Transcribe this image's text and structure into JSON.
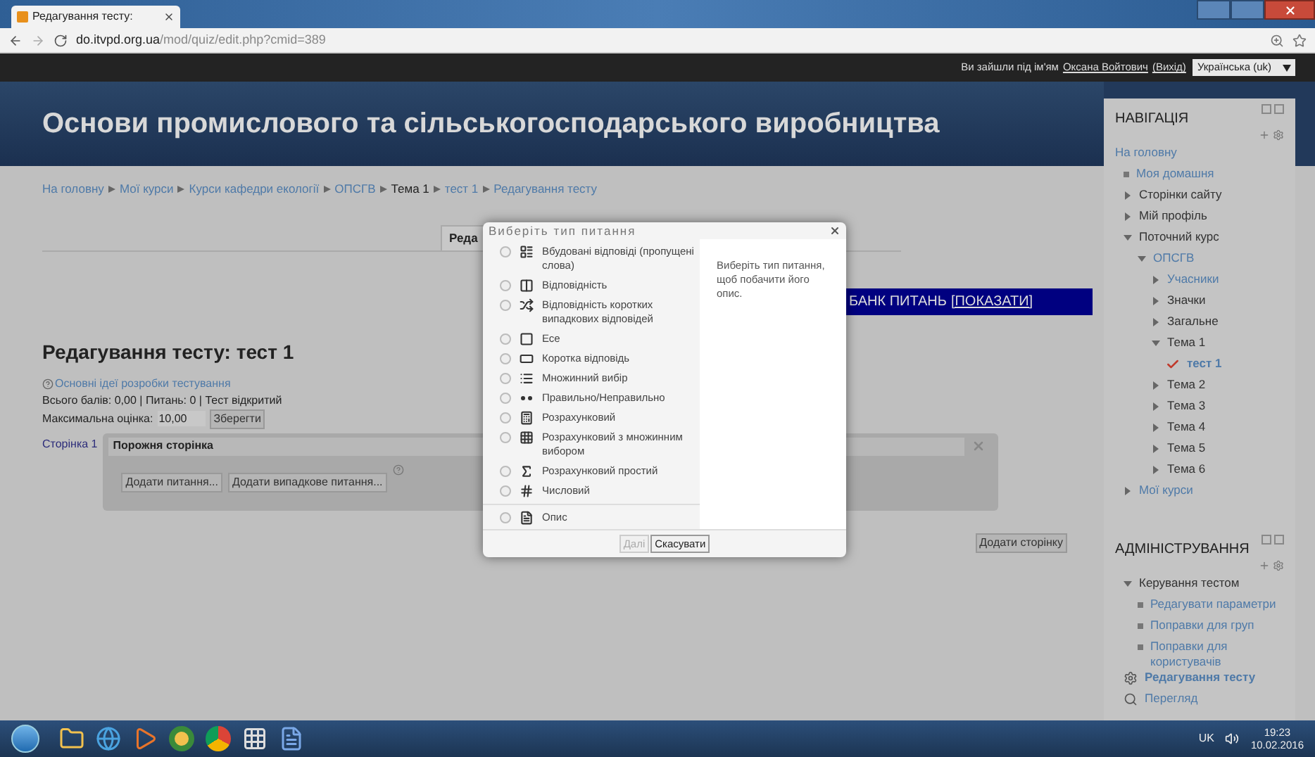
{
  "browser": {
    "tab_title": "Редагування тесту:",
    "address_host": "do.itvpd.org.ua",
    "address_path": "/mod/quiz/edit.php?cmid=389"
  },
  "login_bar": {
    "prefix": "Ви зайшли під ім'ям",
    "user": "Оксана Войтович",
    "logout": "(Вихід)",
    "language": "Українська (uk)"
  },
  "header": {
    "title": "Основи промислового та сільськогосподарського виробництва"
  },
  "breadcrumb": [
    {
      "label": "На головну",
      "link": true
    },
    {
      "label": "Мої курси",
      "link": true
    },
    {
      "label": "Курси кафедри екології",
      "link": true
    },
    {
      "label": "ОПСГВ",
      "link": true
    },
    {
      "label": "Тема 1",
      "link": false
    },
    {
      "label": "тест 1",
      "link": true
    },
    {
      "label": "Редагування тесту",
      "link": true
    }
  ],
  "tab_behind": "Реда",
  "question_bank": {
    "label": "БАНК ПИТАНЬ",
    "action": "[ПОКАЗАТИ]"
  },
  "quiz": {
    "heading": "Редагування тесту: тест 1",
    "help_link": "Основні ідеї розробки тестування",
    "summary": "Всього балів: 0,00 | Питань: 0 | Тест відкритий",
    "max_grade_label": "Максимальна оцінка:",
    "max_grade_value": "10,00",
    "save_button": "Зберегти",
    "page_label": "Сторінка 1",
    "page_title": "Порожня сторінка",
    "buttons": [
      "Додати питання...",
      "Додати випадкове питання..."
    ],
    "add_page_button": "Додати сторінку"
  },
  "dialog": {
    "title": "Виберіть тип питання",
    "question_types": [
      {
        "kind": "embedded",
        "label": "Вбудовані відповіді (пропущені слова)",
        "selected": false
      },
      {
        "kind": "matching",
        "label": "Відповідність",
        "selected": false
      },
      {
        "kind": "random-matching",
        "label": "Відповідність коротких випадкових відповідей",
        "selected": false
      },
      {
        "kind": "essay",
        "label": "Есе",
        "selected": false
      },
      {
        "kind": "short-answer",
        "label": "Коротка відповідь",
        "selected": false
      },
      {
        "kind": "multichoice",
        "label": "Множинний вибір",
        "selected": false
      },
      {
        "kind": "truefalse",
        "label": "Правильно/Неправильно",
        "selected": false
      },
      {
        "kind": "calculated",
        "label": "Розрахунковий",
        "selected": false
      },
      {
        "kind": "calculated-multi",
        "label": "Розрахунковий з множинним вибором",
        "selected": false
      },
      {
        "kind": "calculated-simple",
        "label": "Розрахунковий простий",
        "selected": false
      },
      {
        "kind": "numerical",
        "label": "Числовий",
        "selected": false
      }
    ],
    "other_types": [
      {
        "kind": "description",
        "label": "Опис",
        "selected": false
      }
    ],
    "description": "Виберіть тип питання, щоб побачити його опис.",
    "next_button": {
      "label": "Далі",
      "disabled": true
    },
    "cancel_button": "Скасувати"
  },
  "navigation": {
    "title": "НАВІГАЦІЯ",
    "items": [
      {
        "kind": "home",
        "label": "На головну",
        "link": true,
        "current": false
      },
      {
        "kind": "bullet",
        "label": "Моя домашня",
        "link": true,
        "current": false
      },
      {
        "kind": "branch",
        "label": "Сторінки сайту",
        "link": false,
        "current": false,
        "expanded": false
      },
      {
        "kind": "branch",
        "label": "Мій профіль",
        "link": false,
        "current": false,
        "expanded": false
      },
      {
        "kind": "branch",
        "label": "Поточний курс",
        "link": false,
        "current": false,
        "expanded": true,
        "children": [
          {
            "kind": "branch",
            "label": "ОПСГВ",
            "link": true,
            "current": false,
            "expanded": true,
            "children": [
              {
                "kind": "branch",
                "label": "Учасники",
                "link": true,
                "current": false,
                "expanded": false
              },
              {
                "kind": "branch",
                "label": "Значки",
                "link": false,
                "current": false,
                "expanded": false
              },
              {
                "kind": "branch",
                "label": "Загальне",
                "link": false,
                "current": false,
                "expanded": false
              },
              {
                "kind": "branch",
                "label": "Тема 1",
                "link": false,
                "current": false,
                "expanded": true,
                "children": [
                  {
                    "kind": "activity",
                    "label": "тест 1",
                    "link": true,
                    "current": true
                  }
                ]
              },
              {
                "kind": "branch",
                "label": "Тема 2",
                "link": false,
                "current": false,
                "expanded": false
              },
              {
                "kind": "branch",
                "label": "Тема 3",
                "link": false,
                "current": false,
                "expanded": false
              },
              {
                "kind": "branch",
                "label": "Тема 4",
                "link": false,
                "current": false,
                "expanded": false
              },
              {
                "kind": "branch",
                "label": "Тема 5",
                "link": false,
                "current": false,
                "expanded": false
              },
              {
                "kind": "branch",
                "label": "Тема 6",
                "link": false,
                "current": false,
                "expanded": false
              }
            ]
          }
        ]
      },
      {
        "kind": "branch",
        "label": "Мої курси",
        "link": true,
        "current": false,
        "expanded": false
      }
    ]
  },
  "administration": {
    "title": "АДМІНІСТРУВАННЯ",
    "items": [
      {
        "kind": "branch",
        "label": "Керування тестом",
        "link": false,
        "current": false,
        "expanded": true,
        "children": [
          {
            "kind": "bullet",
            "label": "Редагувати параметри",
            "link": true,
            "current": false
          },
          {
            "kind": "bullet",
            "label": "Поправки для груп",
            "link": true,
            "current": false
          },
          {
            "kind": "bullet",
            "label": "Поправки для користувачів",
            "link": true,
            "current": false
          }
        ]
      },
      {
        "kind": "gear",
        "label": "Редагування тесту",
        "link": true,
        "current": true
      },
      {
        "kind": "search",
        "label": "Перегляд",
        "link": true,
        "current": false
      }
    ]
  },
  "taskbar": {
    "language": "UK",
    "time": "19:23",
    "date": "10.02.2016"
  }
}
